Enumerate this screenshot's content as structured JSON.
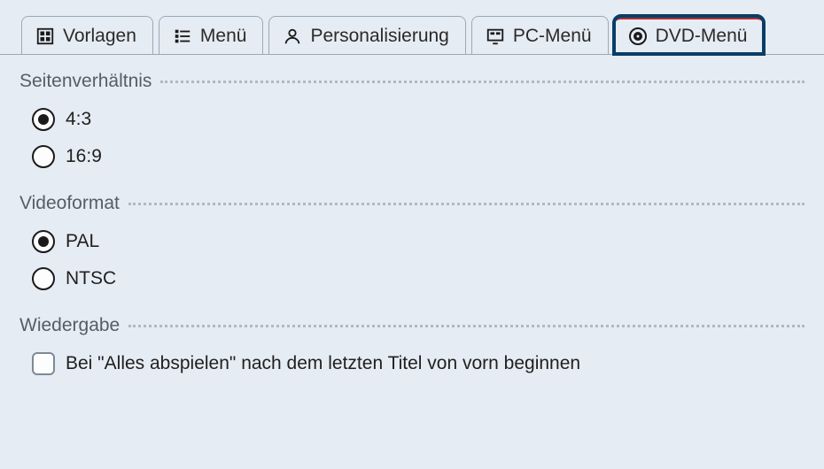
{
  "tabs": [
    {
      "label": "Vorlagen"
    },
    {
      "label": "Menü"
    },
    {
      "label": "Personalisierung"
    },
    {
      "label": "PC-Menü"
    },
    {
      "label": "DVD-Menü"
    }
  ],
  "sections": {
    "aspect": {
      "title": "Seitenverhältnis",
      "options": [
        {
          "label": "4:3",
          "selected": true
        },
        {
          "label": "16:9",
          "selected": false
        }
      ]
    },
    "videoformat": {
      "title": "Videoformat",
      "options": [
        {
          "label": "PAL",
          "selected": true
        },
        {
          "label": "NTSC",
          "selected": false
        }
      ]
    },
    "playback": {
      "title": "Wiedergabe",
      "checkbox_label": "Bei \"Alles abspielen\" nach dem letzten Titel von vorn beginnen"
    }
  }
}
